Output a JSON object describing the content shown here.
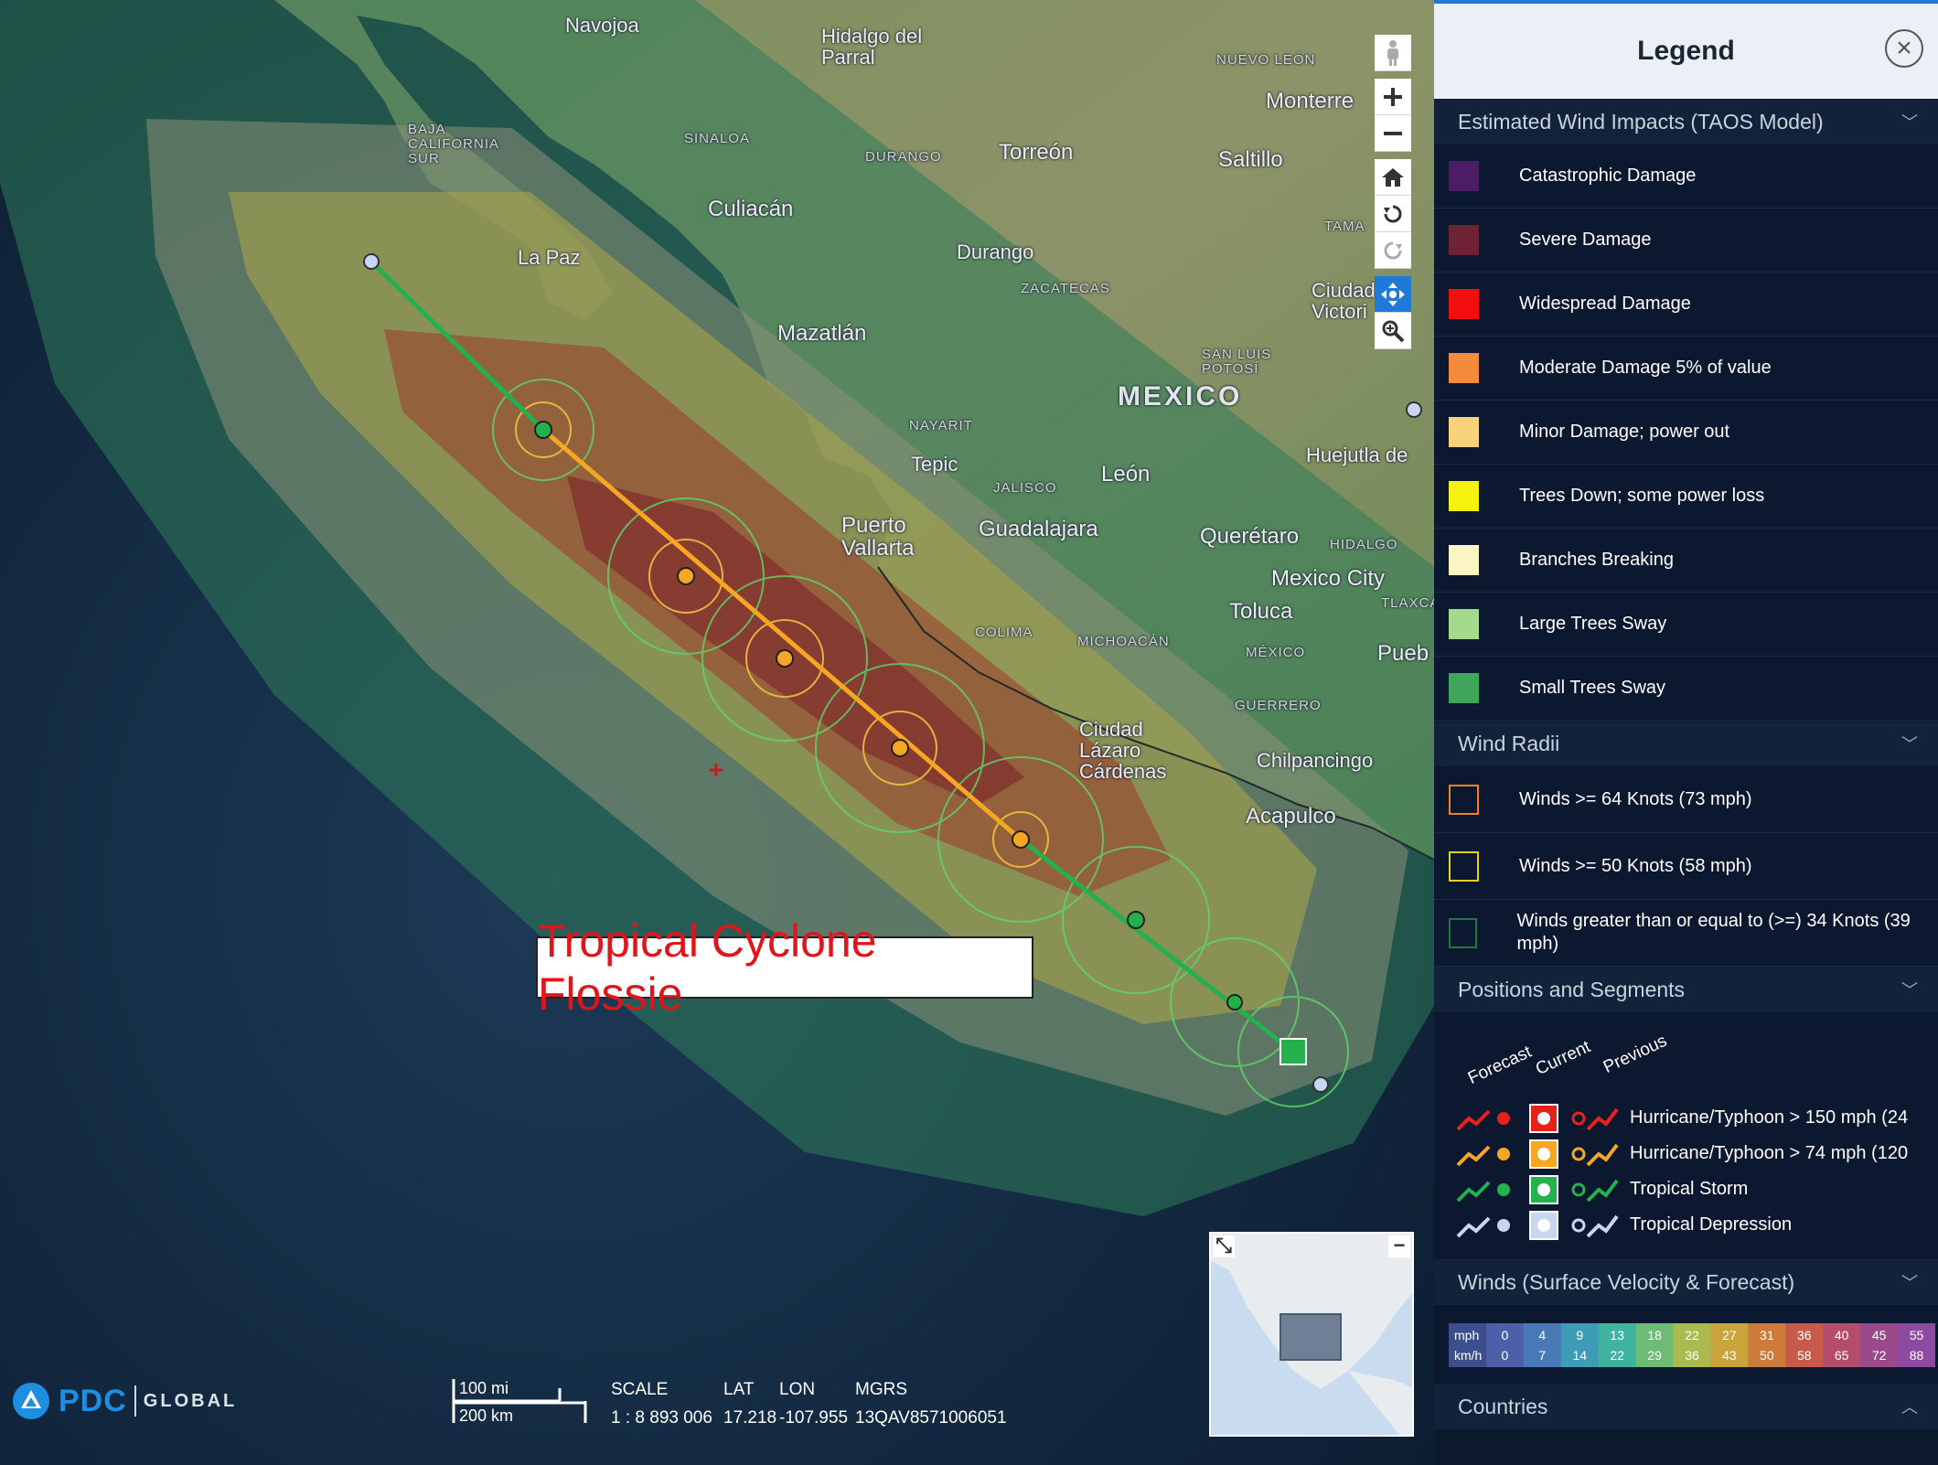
{
  "map": {
    "places": [
      {
        "id": "navojoa",
        "name": "Navojoa",
        "cls": "med"
      },
      {
        "id": "hidalgo",
        "name": "Hidalgo del\nParral",
        "cls": "med"
      },
      {
        "id": "nuevo-leon",
        "name": "NUEVO LEÓN",
        "cls": "state"
      },
      {
        "id": "monterrey",
        "name": "Monterre",
        "cls": "big"
      },
      {
        "id": "baja",
        "name": "BAJA\nCALIFORNIA\nSUR",
        "cls": "state"
      },
      {
        "id": "sinaloa",
        "name": "SINALOA",
        "cls": "state"
      },
      {
        "id": "durango-st",
        "name": "DURANGO",
        "cls": "state"
      },
      {
        "id": "torreon",
        "name": "Torreón",
        "cls": "big"
      },
      {
        "id": "saltillo",
        "name": "Saltillo",
        "cls": "big"
      },
      {
        "id": "culiacan",
        "name": "Culiacán",
        "cls": "big"
      },
      {
        "id": "lapaz",
        "name": "La Paz",
        "cls": "med"
      },
      {
        "id": "durango",
        "name": "Durango",
        "cls": "med"
      },
      {
        "id": "tama",
        "name": "TAMA",
        "cls": "state"
      },
      {
        "id": "zacatecas",
        "name": "ZACATECAS",
        "cls": "state"
      },
      {
        "id": "ciudad-victoria",
        "name": "Ciudad\nVictori",
        "cls": "med"
      },
      {
        "id": "mazatlan",
        "name": "Mazatlán",
        "cls": "big"
      },
      {
        "id": "sanluis",
        "name": "SAN LUIS\nPOTOSÍ",
        "cls": "state"
      },
      {
        "id": "mexico",
        "name": "MEXICO",
        "cls": "country"
      },
      {
        "id": "nayarit",
        "name": "NAYARIT",
        "cls": "state"
      },
      {
        "id": "tepic",
        "name": "Tepic",
        "cls": "med"
      },
      {
        "id": "leon",
        "name": "León",
        "cls": "big"
      },
      {
        "id": "huejutla",
        "name": "Huejutla de",
        "cls": "med"
      },
      {
        "id": "jalisco",
        "name": "JALISCO",
        "cls": "state"
      },
      {
        "id": "puerto-vallarta",
        "name": "Puerto\nVallarta",
        "cls": "big"
      },
      {
        "id": "guadalajara",
        "name": "Guadalajara",
        "cls": "big"
      },
      {
        "id": "queretaro",
        "name": "Querétaro",
        "cls": "big"
      },
      {
        "id": "hidalgo-st",
        "name": "HIDALGO",
        "cls": "state"
      },
      {
        "id": "mexico-city",
        "name": "Mexico City",
        "cls": "big"
      },
      {
        "id": "toluca",
        "name": "Toluca",
        "cls": "big"
      },
      {
        "id": "tlaxca",
        "name": "TLAXCA",
        "cls": "state"
      },
      {
        "id": "colima",
        "name": "COLIMA",
        "cls": "state"
      },
      {
        "id": "michoacan",
        "name": "MICHOACÁN",
        "cls": "state"
      },
      {
        "id": "mexico-st",
        "name": "MÉXICO",
        "cls": "state"
      },
      {
        "id": "puebla",
        "name": "Pueb",
        "cls": "big"
      },
      {
        "id": "lazaro",
        "name": "Ciudad\nLázaro\nCárdenas",
        "cls": "med"
      },
      {
        "id": "guerrero",
        "name": "GUERRERO",
        "cls": "state"
      },
      {
        "id": "chilpancingo",
        "name": "Chilpancingo",
        "cls": "med"
      },
      {
        "id": "acapulco",
        "name": "Acapulco",
        "cls": "big"
      }
    ],
    "storm_label": "Tropical Cyclone Flossie",
    "logo": {
      "pdc": "PDC",
      "global": "GLOBAL"
    },
    "scale": {
      "mi": "100 mi",
      "km": "200 km"
    },
    "readout": {
      "scale_label": "SCALE",
      "scale_value": "1 : 8 893 006",
      "lat_label": "LAT",
      "lat_value": "17.218",
      "lon_label": "LON",
      "lon_value": "-107.955",
      "mgrs_label": "MGRS",
      "mgrs_value": "13QAV8571006051"
    },
    "toolbar": [
      "street-view-icon",
      "zoom-in-icon",
      "zoom-out-icon",
      "home-icon",
      "rotate-left-icon",
      "rotate-right-icon",
      "pan-icon",
      "zoom-box-icon"
    ]
  },
  "legend": {
    "title": "Legend",
    "close_icon": "close-icon",
    "sections": {
      "wind_impacts": {
        "title": "Estimated Wind Impacts (TAOS Model)",
        "items": [
          {
            "label": "Catastrophic Damage",
            "color": "#4a1d66"
          },
          {
            "label": "Severe Damage",
            "color": "#6e2236"
          },
          {
            "label": "Widespread Damage",
            "color": "#f20f0f"
          },
          {
            "label": "Moderate Damage 5% of value",
            "color": "#f48a3c"
          },
          {
            "label": "Minor Damage; power out",
            "color": "#f9d37a"
          },
          {
            "label": "Trees Down; some power loss",
            "color": "#f5f212"
          },
          {
            "label": "Branches Breaking",
            "color": "#fbf6c4"
          },
          {
            "label": "Large Trees Sway",
            "color": "#a5d98c"
          },
          {
            "label": "Small Trees Sway",
            "color": "#3fa55a"
          }
        ]
      },
      "wind_radii": {
        "title": "Wind Radii",
        "items": [
          {
            "label": "Winds >= 64 Knots (73 mph)",
            "color": "#f58220"
          },
          {
            "label": "Winds >= 50 Knots (58 mph)",
            "color": "#e6d21c"
          },
          {
            "label": "Winds greater than or equal to (>=) 34 Knots (39 mph)",
            "color": "#1d7a3a"
          }
        ]
      },
      "positions": {
        "title": "Positions and Segments",
        "headers": [
          "Forecast",
          "Current",
          "Previous"
        ],
        "rows": [
          {
            "label": "Hurricane/Typhoon > 150 mph (24",
            "color": "#e8221b"
          },
          {
            "label": "Hurricane/Typhoon > 74 mph (120",
            "color": "#f5a623"
          },
          {
            "label": "Tropical Storm",
            "color": "#22b14c"
          },
          {
            "label": "Tropical Depression",
            "color": "#c9d6f2"
          }
        ]
      },
      "winds": {
        "title": "Winds (Surface Velocity & Forecast)",
        "mph_label": "mph",
        "kmh_label": "km/h",
        "mph": [
          "0",
          "4",
          "9",
          "13",
          "18",
          "22",
          "27",
          "31",
          "36",
          "40",
          "45",
          "55"
        ],
        "kmh": [
          "0",
          "7",
          "14",
          "22",
          "29",
          "36",
          "43",
          "50",
          "58",
          "65",
          "72",
          "88"
        ],
        "colors": [
          "#4d5fa8",
          "#4a79b8",
          "#3f9cb6",
          "#3fb2a0",
          "#6dbb75",
          "#a9bb4f",
          "#c9a43d",
          "#cc7b3a",
          "#c75a4a",
          "#b44d6c",
          "#9a4a8b",
          "#8c4aa3"
        ]
      },
      "countries": {
        "title": "Countries"
      }
    }
  }
}
